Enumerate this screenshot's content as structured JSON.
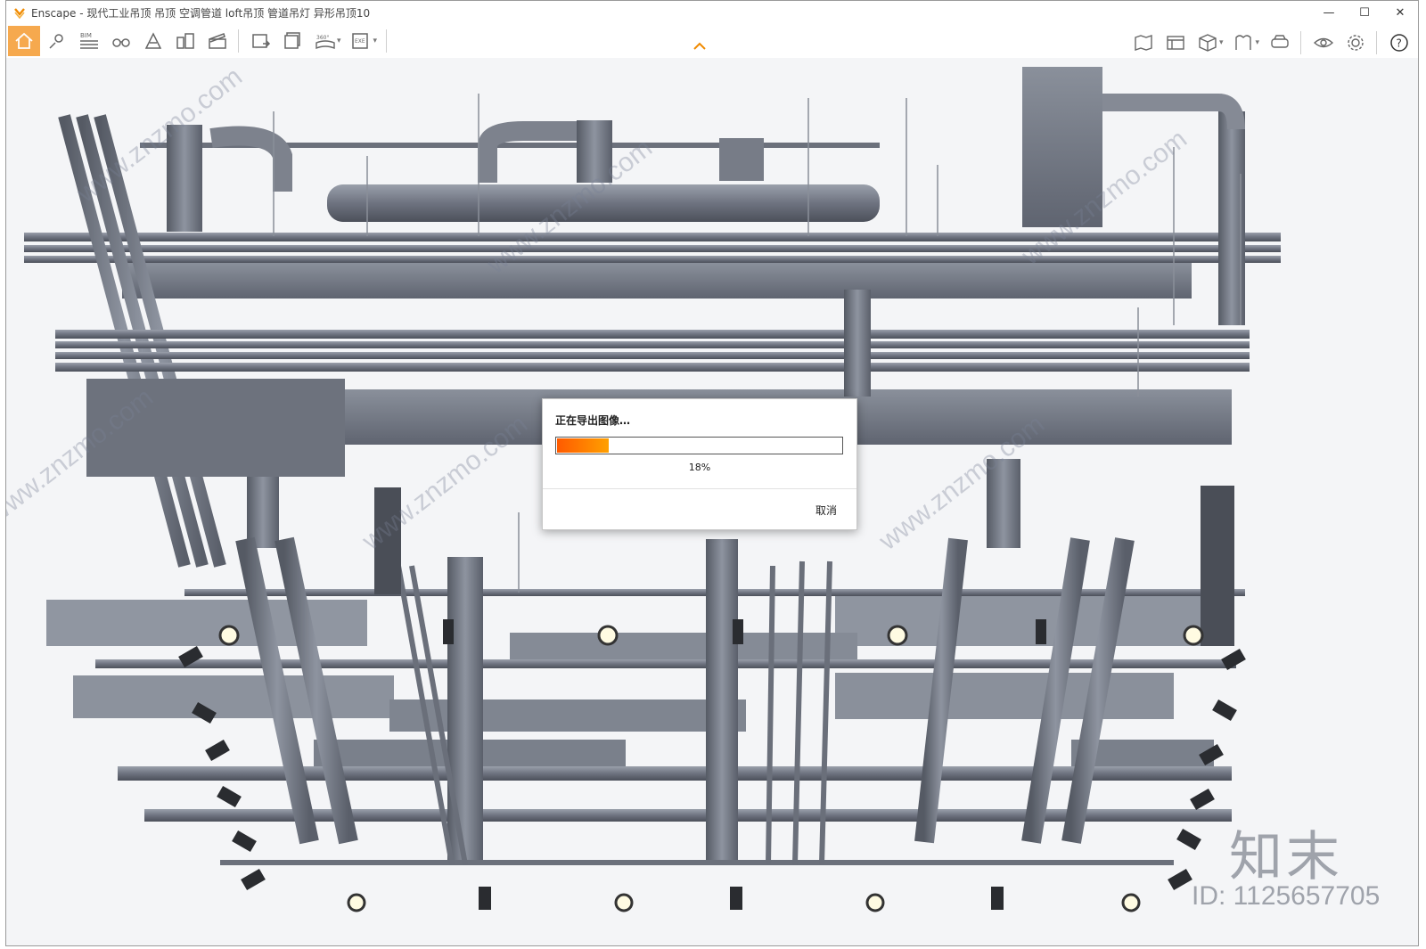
{
  "window": {
    "title": "Enscape - 现代工业吊顶 吊顶 空调管道 loft吊顶 管道吊灯 异形吊顶10",
    "controls": {
      "minimize": "—",
      "maximize": "☐",
      "close": "✕"
    }
  },
  "toolbar": {
    "left_tools": [
      {
        "name": "home-icon",
        "active": true
      },
      {
        "name": "location-pin-icon"
      },
      {
        "name": "bim-icon",
        "label": "BIM"
      },
      {
        "name": "binoculars-icon"
      },
      {
        "name": "landscape-icon"
      },
      {
        "name": "buildings-icon"
      },
      {
        "name": "clapperboard-icon"
      },
      {
        "name": "screenshot-export-icon"
      },
      {
        "name": "batch-export-icon"
      },
      {
        "name": "panorama-360-icon",
        "label": "360°"
      },
      {
        "name": "exe-export-icon",
        "label": "EXE"
      }
    ],
    "right_tools": [
      {
        "name": "map-icon"
      },
      {
        "name": "asset-library-icon"
      },
      {
        "name": "cube-view-icon"
      },
      {
        "name": "atlas-icon"
      },
      {
        "name": "vr-headset-icon"
      },
      {
        "name": "eye-icon"
      },
      {
        "name": "settings-gear-icon"
      },
      {
        "name": "help-icon",
        "label": "?"
      }
    ],
    "accent": "#f6a94e"
  },
  "dialog": {
    "title": "正在导出图像…",
    "progress_percent": 18,
    "progress_label": "18%",
    "cancel_label": "取消"
  },
  "watermark": {
    "site": "www.znzmo.com",
    "logo": "知末",
    "id": "ID: 1125657705"
  }
}
